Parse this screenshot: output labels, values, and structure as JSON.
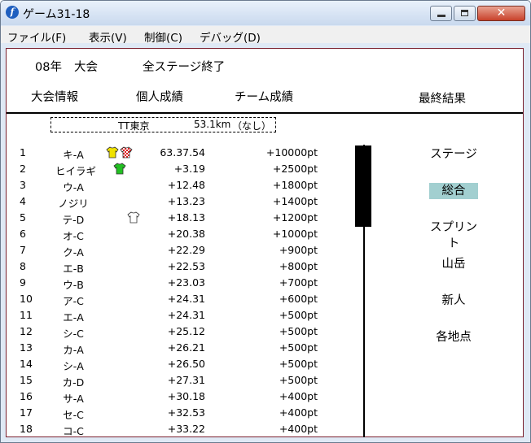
{
  "window": {
    "title": "ゲーム31-18",
    "icon": "f-app-icon",
    "close_glyph": "✕"
  },
  "menu": [
    "ファイル(F)",
    "表示(V)",
    "制御(C)",
    "デバッグ(D)"
  ],
  "header": {
    "year": "08年",
    "event": "大会",
    "status": "全ステージ終了",
    "tabs": [
      "大会情報",
      "個人成績",
      "チーム成績"
    ],
    "final_result": "最終結果"
  },
  "stage": {
    "name": "TT東京",
    "distance": "53.1km",
    "note": "（なし）"
  },
  "rows": [
    {
      "rank": "1",
      "name": "キ-A",
      "time": "63.37.54",
      "points": "+10000pt",
      "jerseys": [
        "yellow",
        "polka"
      ]
    },
    {
      "rank": "2",
      "name": "ヒイラギ",
      "time": "+3.19",
      "points": "+2500pt",
      "jerseys": [
        "green"
      ]
    },
    {
      "rank": "3",
      "name": "ウ-A",
      "time": "+12.48",
      "points": "+1800pt",
      "jerseys": []
    },
    {
      "rank": "4",
      "name": "ノジリ",
      "time": "+13.23",
      "points": "+1400pt",
      "jerseys": []
    },
    {
      "rank": "5",
      "name": "テ-D",
      "time": "+18.13",
      "points": "+1200pt",
      "jerseys": [
        "white"
      ]
    },
    {
      "rank": "6",
      "name": "オ-C",
      "time": "+20.38",
      "points": "+1000pt",
      "jerseys": []
    },
    {
      "rank": "7",
      "name": "ク-A",
      "time": "+22.29",
      "points": "+900pt",
      "jerseys": []
    },
    {
      "rank": "8",
      "name": "エ-B",
      "time": "+22.53",
      "points": "+800pt",
      "jerseys": []
    },
    {
      "rank": "9",
      "name": "ウ-B",
      "time": "+23.03",
      "points": "+700pt",
      "jerseys": []
    },
    {
      "rank": "10",
      "name": "ア-C",
      "time": "+24.31",
      "points": "+600pt",
      "jerseys": []
    },
    {
      "rank": "11",
      "name": "エ-A",
      "time": "+24.31",
      "points": "+500pt",
      "jerseys": []
    },
    {
      "rank": "12",
      "name": "シ-C",
      "time": "+25.12",
      "points": "+500pt",
      "jerseys": []
    },
    {
      "rank": "13",
      "name": "カ-A",
      "time": "+26.21",
      "points": "+500pt",
      "jerseys": []
    },
    {
      "rank": "14",
      "name": "シ-A",
      "time": "+26.50",
      "points": "+500pt",
      "jerseys": []
    },
    {
      "rank": "15",
      "name": "カ-D",
      "time": "+27.31",
      "points": "+500pt",
      "jerseys": []
    },
    {
      "rank": "16",
      "name": "サ-A",
      "time": "+30.18",
      "points": "+400pt",
      "jerseys": []
    },
    {
      "rank": "17",
      "name": "セ-C",
      "time": "+32.53",
      "points": "+400pt",
      "jerseys": []
    },
    {
      "rank": "18",
      "name": "コ-C",
      "time": "+33.22",
      "points": "+400pt",
      "jerseys": []
    }
  ],
  "categories": [
    {
      "label": "ステージ"
    },
    {
      "label": "総合",
      "active": true
    },
    {
      "label": "スプリント"
    },
    {
      "label": "山岳"
    },
    {
      "label": "新人"
    },
    {
      "label": "各地点"
    }
  ],
  "colors": {
    "yellow_jersey": "#f0e200",
    "green_jersey": "#22c022",
    "polka_jersey": "#e02020",
    "active_category": "#a2cfd0",
    "frame": "#7a1f2d"
  }
}
